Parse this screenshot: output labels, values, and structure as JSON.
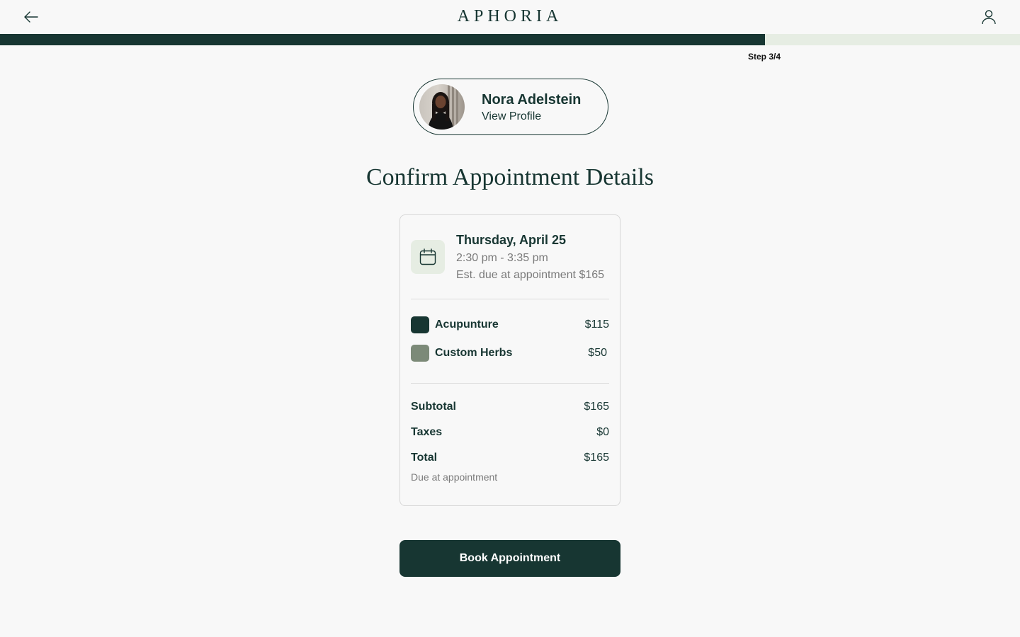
{
  "header": {
    "brand": "APHORIA",
    "back_icon": "arrow-left-icon",
    "user_icon": "user-icon"
  },
  "progress": {
    "fraction": 0.75,
    "step_label": "Step 3/4"
  },
  "provider": {
    "name": "Nora Adelstein",
    "link_label": "View Profile"
  },
  "page_title": "Confirm Appointment Details",
  "appointment": {
    "icon": "calendar-icon",
    "date": "Thursday, April 25",
    "time": "2:30 pm - 3:35 pm",
    "est_due": "Est. due at appointment $165"
  },
  "services": [
    {
      "name": "Acupunture",
      "price": "$115",
      "color": "#173632"
    },
    {
      "name": "Custom Herbs",
      "price": "$50",
      "color": "#7c8a78"
    }
  ],
  "summary": {
    "subtotal_label": "Subtotal",
    "subtotal_value": "$165",
    "taxes_label": "Taxes",
    "taxes_value": "$0",
    "total_label": "Total",
    "total_value": "$165",
    "note": "Due at appointment"
  },
  "cta": {
    "label": "Book Appointment"
  },
  "colors": {
    "primary": "#173632",
    "track": "#e6ede3",
    "muted_text": "#7a7a7a"
  }
}
